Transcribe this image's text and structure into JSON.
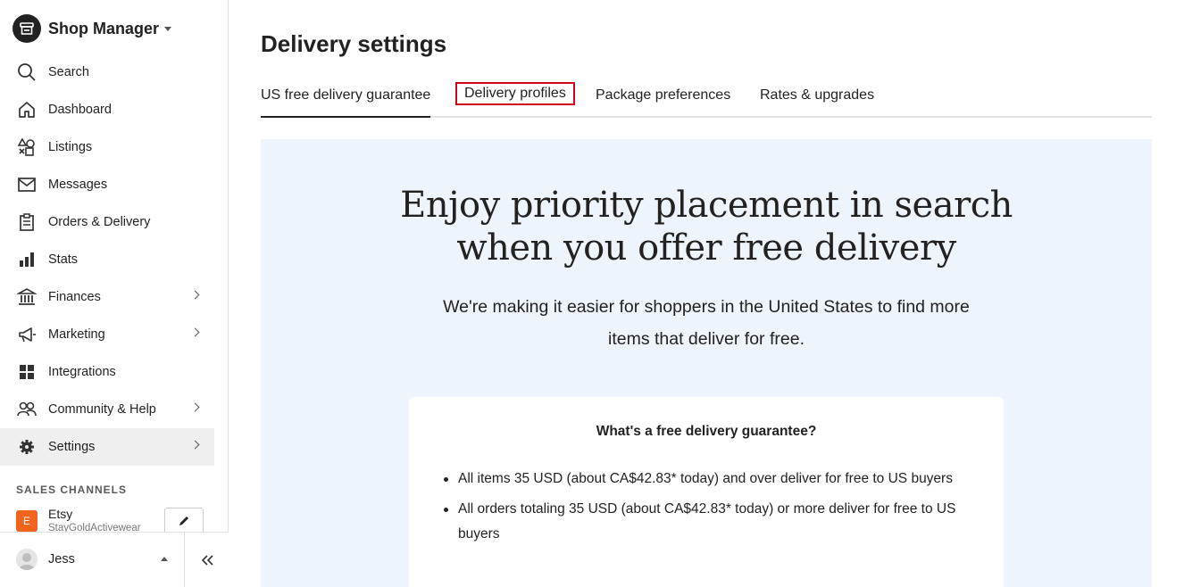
{
  "sidebar": {
    "shop_title": "Shop Manager",
    "items": [
      {
        "label": "Search",
        "icon": "search-icon"
      },
      {
        "label": "Dashboard",
        "icon": "home-icon"
      },
      {
        "label": "Listings",
        "icon": "shapes-icon"
      },
      {
        "label": "Messages",
        "icon": "envelope-icon"
      },
      {
        "label": "Orders & Delivery",
        "icon": "clipboard-icon"
      },
      {
        "label": "Stats",
        "icon": "bar-chart-icon"
      },
      {
        "label": "Finances",
        "icon": "bank-icon"
      },
      {
        "label": "Marketing",
        "icon": "megaphone-icon"
      },
      {
        "label": "Integrations",
        "icon": "grid-icon"
      },
      {
        "label": "Community & Help",
        "icon": "people-icon"
      },
      {
        "label": "Settings",
        "icon": "gear-icon"
      }
    ],
    "sales_channels_title": "SALES CHANNELS",
    "channel": {
      "badge": "E",
      "name": "Etsy",
      "sub": "StayGoldActivewear"
    },
    "user": {
      "name": "Jess"
    }
  },
  "main": {
    "title": "Delivery settings",
    "tabs": [
      {
        "label": "US free delivery guarantee"
      },
      {
        "label": "Delivery profiles"
      },
      {
        "label": "Package preferences"
      },
      {
        "label": "Rates & upgrades"
      }
    ],
    "promo": {
      "headline_line1": "Enjoy priority placement in search",
      "headline_line2": "when you offer free delivery",
      "subtext": "We're making it easier for shoppers in the United States to find more items that deliver for free."
    },
    "card": {
      "title": "What's a free delivery guarantee?",
      "bullets": [
        "All items 35 USD (about CA$42.83* today) and over deliver for free to US buyers",
        "All orders totaling 35 USD (about CA$42.83* today) or more deliver for free to US buyers"
      ]
    }
  },
  "colors": {
    "promo_bg": "#edf4fc",
    "etsy_orange": "#f1641e",
    "highlight_red": "#d0021b",
    "active_nav_bg": "#efefef"
  }
}
